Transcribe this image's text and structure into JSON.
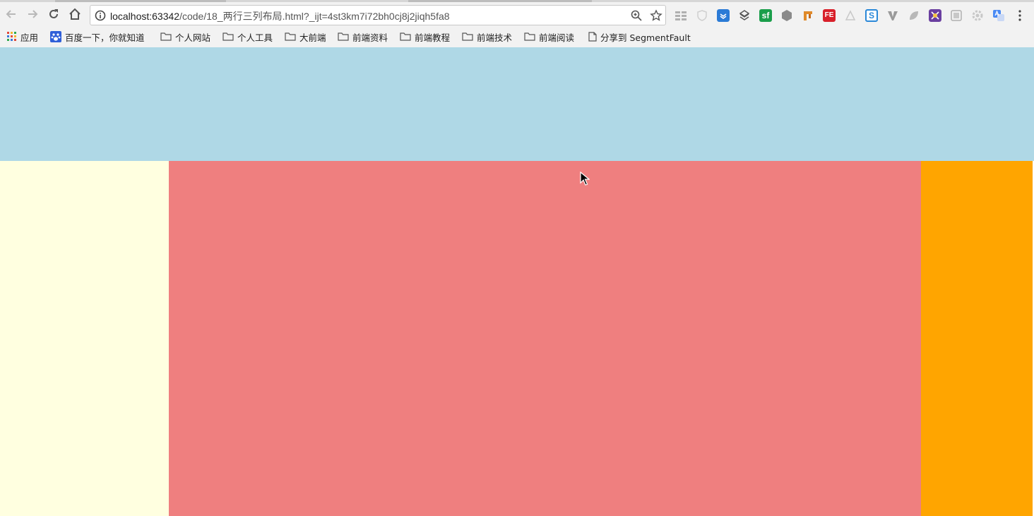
{
  "browser": {
    "url_host": "localhost:63342",
    "url_path": "/code/18_两行三列布局.html?_ijt=4st3km7i72bh0cj8j2jiqh5fa8",
    "nav_icons": [
      "back-icon",
      "forward-icon",
      "reload-icon",
      "home-icon"
    ],
    "omnibox_icons": [
      "info-icon",
      "zoom-icon",
      "bookmark-star-icon"
    ],
    "extensions": [
      "grid-ext-icon",
      "shield-ext-icon",
      "blue-ext-icon",
      "layers-ext-icon",
      "sf-ext-icon",
      "hex-ext-icon",
      "tool-ext-icon",
      "fe-ext-icon",
      "triangle-ext-icon",
      "s-ext-icon",
      "v-ext-icon",
      "leaf-ext-icon",
      "purple-ext-icon",
      "box-ext-icon",
      "gear-ext-icon",
      "translate-ext-icon",
      "menu-icon"
    ],
    "sf_label": "sf",
    "fe_label": "FE",
    "s_label": "S"
  },
  "bookmarks": {
    "apps": "应用",
    "baidu": "百度一下，你就知道",
    "folders": [
      "个人网站",
      "个人工具",
      "大前端",
      "前端资料",
      "前端教程",
      "前端技术",
      "前端阅读"
    ],
    "segmentfault": "分享到 SegmentFault"
  },
  "colors": {
    "header": "#afd8e6",
    "left": "#ffffe0",
    "center": "#ef7f7f",
    "right": "#ffa500"
  }
}
